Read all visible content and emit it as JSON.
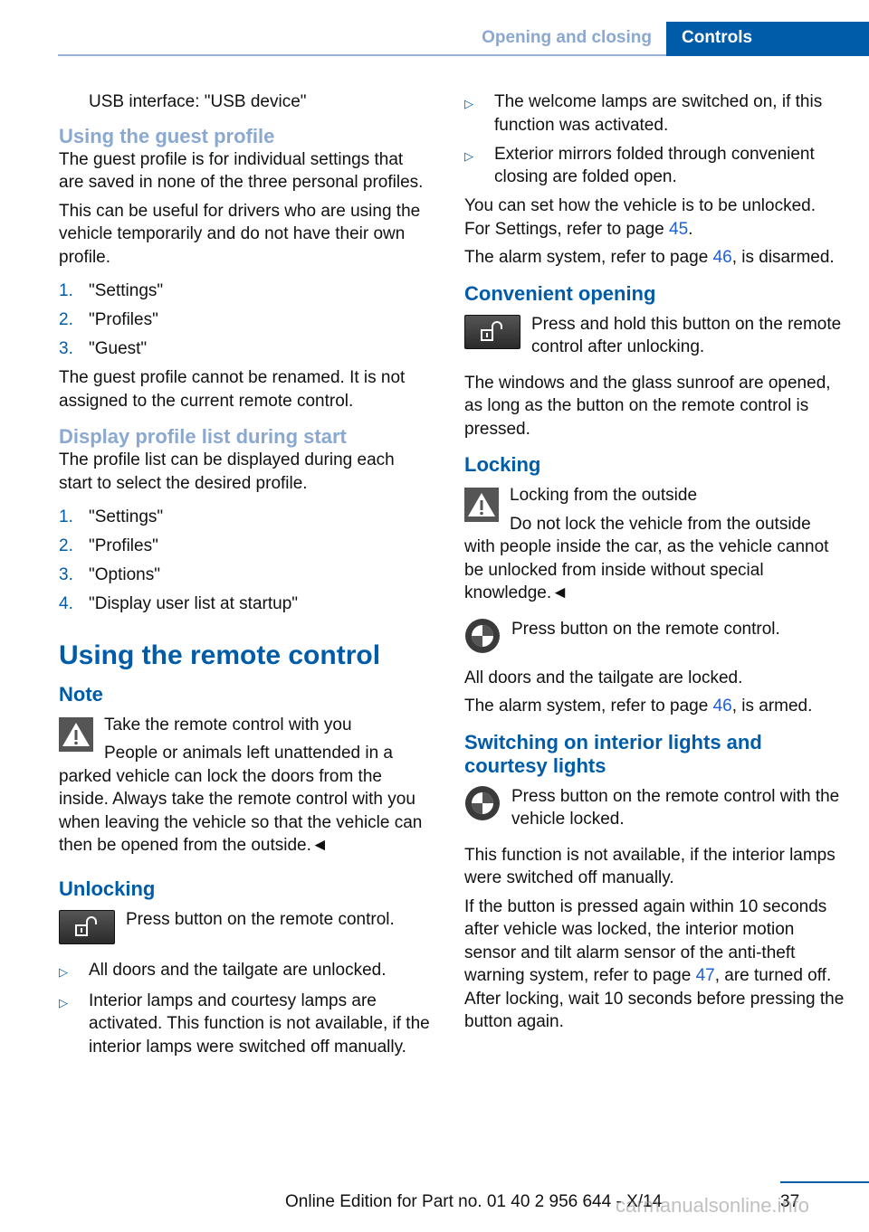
{
  "header": {
    "section": "Opening and closing",
    "chapter": "Controls"
  },
  "left": {
    "usb_line": "USB interface: \"USB device\"",
    "guest": {
      "title": "Using the guest profile",
      "p1": "The guest profile is for individual settings that are saved in none of the three personal profiles.",
      "p2": "This can be useful for drivers who are using the vehicle temporarily and do not have their own profile.",
      "steps": [
        {
          "n": "1.",
          "t": "\"Settings\""
        },
        {
          "n": "2.",
          "t": "\"Profiles\""
        },
        {
          "n": "3.",
          "t": "\"Guest\""
        }
      ],
      "p3": "The guest profile cannot be renamed. It is not assigned to the current remote control."
    },
    "display": {
      "title": "Display profile list during start",
      "p1": "The profile list can be displayed during each start to select the desired profile.",
      "steps": [
        {
          "n": "1.",
          "t": "\"Settings\""
        },
        {
          "n": "2.",
          "t": "\"Profiles\""
        },
        {
          "n": "3.",
          "t": "\"Options\""
        },
        {
          "n": "4.",
          "t": "\"Display user list at startup\""
        }
      ]
    },
    "remote": {
      "title": "Using the remote control",
      "note_title": "Note",
      "warn_title": "Take the remote control with you",
      "warn_text": "People or animals left unattended in a parked vehicle can lock the doors from the inside. Always take the remote control with you when leaving the vehicle so that the vehicle can then be opened from the outside.◄"
    },
    "unlocking": {
      "title": "Unlocking",
      "press": "Press button on the remote control.",
      "bullets": [
        "All doors and the tailgate are unlocked.",
        "Interior lamps and courtesy lamps are activated. This function is not available, if the interior lamps were switched off manually."
      ]
    }
  },
  "right": {
    "bullets": [
      "The welcome lamps are switched on, if this function was activated.",
      "Exterior mirrors folded through convenient closing are folded open."
    ],
    "settings_text": "You can set how the vehicle is to be unlocked. For Settings, refer to page ",
    "settings_page": "45",
    "alarm_text": "The alarm system, refer to page ",
    "alarm_page": "46",
    "alarm_tail": ", is disarmed.",
    "convenient": {
      "title": "Convenient opening",
      "press": "Press and hold this button on the remote control after unlocking.",
      "p1": "The windows and the glass sunroof are opened, as long as the button on the remote control is pressed."
    },
    "locking": {
      "title": "Locking",
      "warn_title": "Locking from the outside",
      "warn_text": "Do not lock the vehicle from the outside with people inside the car, as the vehicle cannot be unlocked from inside without special knowledge.◄",
      "press": "Press button on the remote control.",
      "p1": "All doors and the tailgate are locked.",
      "alarm_text": "The alarm system, refer to page ",
      "alarm_page": "46",
      "alarm_tail": ", is armed."
    },
    "lights": {
      "title": "Switching on interior lights and courtesy lights",
      "press": "Press button on the remote control with the vehicle locked.",
      "p1": "This function is not available, if the interior lamps were switched off manually.",
      "p2a": "If the button is pressed again within 10 seconds after vehicle was locked, the interior motion sensor and tilt alarm sensor of the anti-theft warning system, refer to page ",
      "p2_page": "47",
      "p2b": ", are turned off. After locking, wait 10 seconds before pressing the button again."
    }
  },
  "footer": {
    "edition": "Online Edition for Part no. 01 40 2 956 644 - X/14",
    "page": "37",
    "watermark": "carmanualsonline.info"
  }
}
